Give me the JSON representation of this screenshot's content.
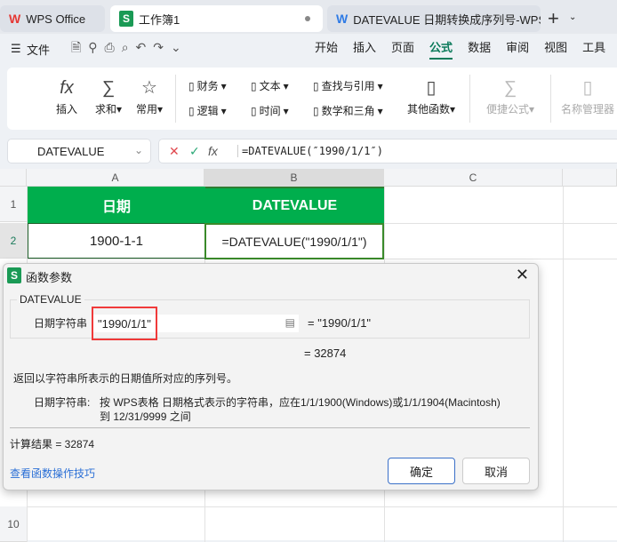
{
  "tabs": [
    {
      "label": "WPS Office"
    },
    {
      "label": "工作簿1"
    },
    {
      "label": "DATEVALUE 日期转换成序列号-WPS"
    }
  ],
  "menu": {
    "file": "文件",
    "items": [
      "开始",
      "插入",
      "页面",
      "公式",
      "数据",
      "审阅",
      "视图",
      "工具"
    ],
    "active": "公式"
  },
  "ribbon": {
    "insert": "插入",
    "sum": "求和",
    "common": "常用",
    "finance": "财务",
    "text": "文本",
    "lookup": "查找与引用",
    "logic": "逻辑",
    "time": "时间",
    "math": "数学和三角",
    "other": "其他函数",
    "quick": "便捷公式",
    "names": "名称管理器"
  },
  "formula_bar": {
    "name_box": "DATEVALUE",
    "formula": "=DATEVALUE(″1990/1/1″)"
  },
  "sheet": {
    "columns": [
      "A",
      "B",
      "C"
    ],
    "rows": [
      "1",
      "2",
      "10"
    ],
    "a1": "日期",
    "b1": "DATEVALUE",
    "a2": "1900-1-1",
    "b2": "=DATEVALUE(\"1990/1/1\")",
    "header_color": "#00ae4d"
  },
  "dialog": {
    "title": "函数参数",
    "func": "DATEVALUE",
    "arg_label": "日期字符串",
    "arg_value": "\"1990/1/1\"",
    "arg_result": "= \"1990/1/1\"",
    "result": "= 32874",
    "description": "返回以字符串所表示的日期值所对应的序列号。",
    "arg_help_label": "日期字符串:",
    "arg_help_1": "按 WPS表格 日期格式表示的字符串，应在1/1/1900(Windows)或1/1/1904(Macintosh)",
    "arg_help_2": "到 12/31/9999 之间",
    "calc_result": "计算结果 = 32874",
    "tips_link": "查看函数操作技巧",
    "ok": "确定",
    "cancel": "取消"
  }
}
